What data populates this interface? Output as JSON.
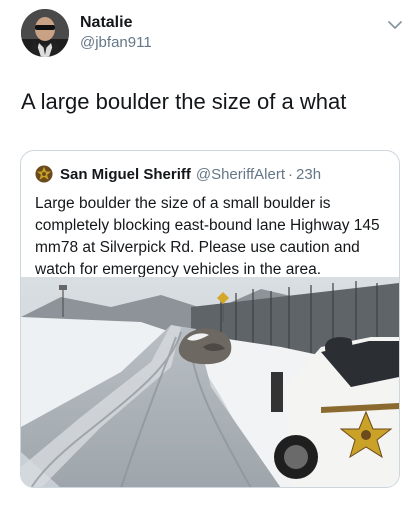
{
  "tweet": {
    "display_name": "Natalie",
    "handle": "@jbfan911",
    "text": "A large boulder the size of a what",
    "avatar_icon": "avatar-icon",
    "menu_icon": "chevron-down-icon"
  },
  "quoted_tweet": {
    "display_name": "San Miguel Sheriff",
    "handle": "@SheriffAlert",
    "separator": "·",
    "time": "23h",
    "badge_icon": "sheriff-star-icon",
    "text": "Large boulder the size of a small boulder is completely blocking east-bound lane Highway 145 mm78 at Silverpick Rd. Please use caution and watch for emergency vehicles in the area.",
    "photo_icon": "road-boulder-photo"
  },
  "colors": {
    "text_primary": "#14171a",
    "text_secondary": "#657786",
    "border": "#ccd6dd",
    "badge_gold": "#c9a227"
  }
}
